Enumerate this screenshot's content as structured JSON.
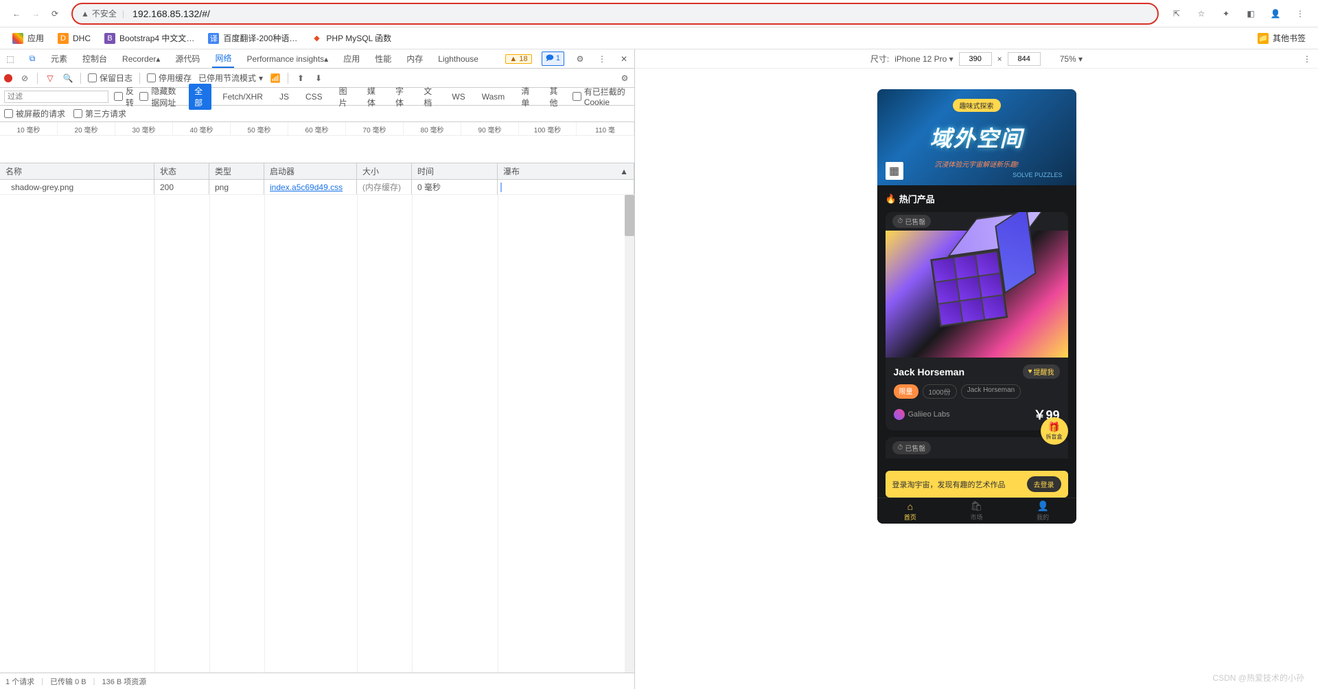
{
  "browser": {
    "insecure_label": "不安全",
    "url": "192.168.85.132/#/"
  },
  "bookmarks": {
    "apps": "应用",
    "items": [
      {
        "label": "DHC"
      },
      {
        "label": "Bootstrap4 中文文…"
      },
      {
        "label": "百度翻译-200种语…"
      },
      {
        "label": "PHP MySQL 函数"
      }
    ],
    "other": "其他书签"
  },
  "devtools": {
    "tabs": [
      "元素",
      "控制台",
      "Recorder",
      "源代码",
      "网络",
      "Performance insights",
      "应用",
      "性能",
      "内存",
      "Lighthouse"
    ],
    "warn_count": "18",
    "info_count": "1",
    "toolbar2": {
      "preserve_log": "保留日志",
      "disable_cache": "停用缓存",
      "throttle": "已停用节流模式"
    },
    "filter": {
      "placeholder": "过滤",
      "invert": "反转",
      "hide_data_urls": "隐藏数据网址",
      "types": [
        "全部",
        "Fetch/XHR",
        "JS",
        "CSS",
        "图片",
        "媒体",
        "字体",
        "文档",
        "WS",
        "Wasm",
        "清单",
        "其他"
      ],
      "blocked_cookies": "有已拦截的 Cookie",
      "blocked_requests": "被屏蔽的请求",
      "third_party": "第三方请求"
    },
    "timeline_ticks": [
      "10 毫秒",
      "20 毫秒",
      "30 毫秒",
      "40 毫秒",
      "50 毫秒",
      "60 毫秒",
      "70 毫秒",
      "80 毫秒",
      "90 毫秒",
      "100 毫秒",
      "110 毫"
    ],
    "columns": {
      "name": "名称",
      "status": "状态",
      "type": "类型",
      "initiator": "启动器",
      "size": "大小",
      "time": "时间",
      "waterfall": "瀑布"
    },
    "rows": [
      {
        "name": "shadow-grey.png",
        "status": "200",
        "type": "png",
        "initiator": "index.a5c69d49.css",
        "size": "(内存缓存)",
        "time": "0 毫秒"
      }
    ],
    "status_bar": {
      "requests": "1 个请求",
      "transferred": "已传输 0 B",
      "resources": "136 B 项资源"
    }
  },
  "device_bar": {
    "label": "尺寸:",
    "device": "iPhone 12 Pro",
    "width": "390",
    "height": "844",
    "zoom": "75%"
  },
  "phone": {
    "banner": {
      "tag": "趣味式探索",
      "title": "域外空间",
      "subtitle": "沉浸体验元宇宙解谜新乐趣!",
      "subtitle2": "SOLVE PUZZLES"
    },
    "section_title": "热门产品",
    "product": {
      "sold_label": "已售罄",
      "title": "Jack Horseman",
      "remind": "提醒我",
      "limit_label": "限量",
      "count_label": "1000份",
      "series_label": "Jack Horseman",
      "author": "Galiieo Labs",
      "price": "￥99"
    },
    "float_btn": "拆盲盒",
    "peek_sold": "已售罄",
    "login": {
      "text": "登录淘宇宙，发现有趣的艺术作品",
      "btn": "去登录"
    },
    "tabs": [
      {
        "label": "首页"
      },
      {
        "label": "市场"
      },
      {
        "label": "我的"
      }
    ]
  },
  "watermark": "CSDN @热爱技术的小孙"
}
